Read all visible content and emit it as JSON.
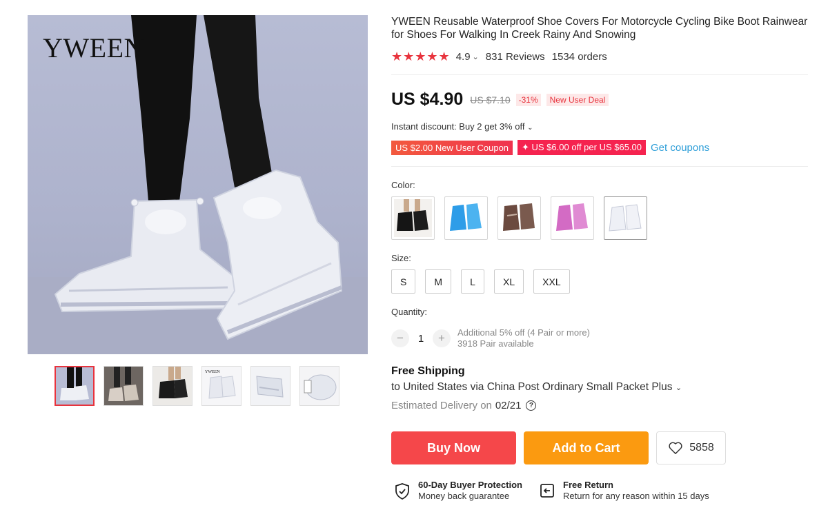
{
  "gallery": {
    "brand_logo": "YWEEN",
    "thumbnails": [
      {
        "name": "thumb-1",
        "active": true
      },
      {
        "name": "thumb-2",
        "active": false
      },
      {
        "name": "thumb-3",
        "active": false
      },
      {
        "name": "thumb-4",
        "active": false
      },
      {
        "name": "thumb-5",
        "active": false
      },
      {
        "name": "thumb-6",
        "active": false
      }
    ],
    "thumb4_logo": "YWEEN"
  },
  "product": {
    "title": "YWEEN Reusable Waterproof Shoe Covers For Motorcycle Cycling Bike Boot Rainwear for Shoes For Walking In Creek Rainy And Snowing",
    "stars": "★★★★★",
    "rating": "4.9",
    "reviews": "831 Reviews",
    "orders": "1534 orders"
  },
  "price": {
    "current": "US $4.90",
    "original": "US $7.10",
    "discount_pct": "-31%",
    "deal_label": "New User Deal"
  },
  "promotions": {
    "instant_discount": "Instant discount: Buy 2 get 3% off",
    "coupon_1": "US $2.00 New User Coupon",
    "coupon_2": "✦ US $6.00 off per US $65.00",
    "get_coupons": "Get coupons"
  },
  "options": {
    "color_label": "Color:",
    "colors": [
      "black",
      "blue",
      "brown",
      "pink",
      "clear"
    ],
    "size_label": "Size:",
    "sizes": [
      "S",
      "M",
      "L",
      "XL",
      "XXL"
    ],
    "quantity_label": "Quantity:",
    "quantity": "1",
    "qty_note_1": "Additional 5% off (4 Pair or more)",
    "qty_note_2": "3918 Pair available"
  },
  "shipping": {
    "title": "Free Shipping",
    "to": "to United States via China Post Ordinary Small Packet Plus",
    "eta_label": "Estimated Delivery on",
    "eta_date": "02/21"
  },
  "actions": {
    "buy_now": "Buy Now",
    "add_to_cart": "Add to Cart",
    "wishlist_count": "5858"
  },
  "guarantees": {
    "protection_title": "60-Day Buyer Protection",
    "protection_sub": "Money back guarantee",
    "return_title": "Free Return",
    "return_sub": "Return for any reason within 15 days"
  },
  "colors": {
    "accent_red": "#e8333d",
    "buy_now": "#f5474a",
    "add_to_cart": "#fb9a10",
    "link_blue": "#2d9ed8"
  }
}
